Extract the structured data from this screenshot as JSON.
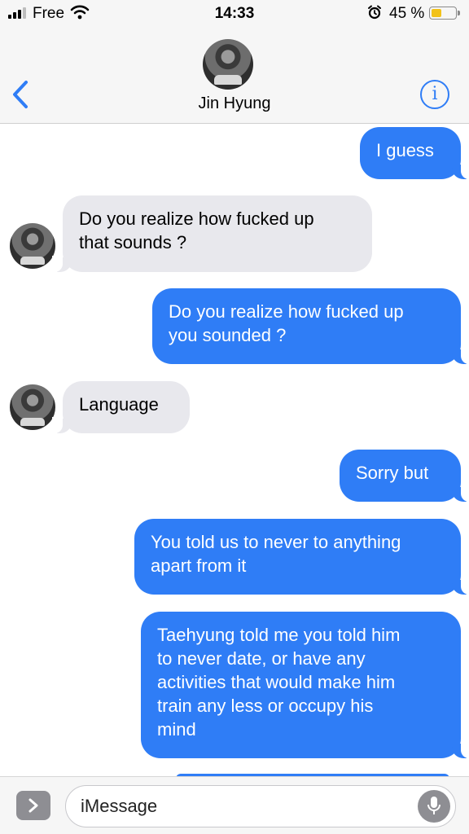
{
  "status_bar": {
    "carrier": "Free",
    "time": "14:33",
    "battery_percent": "45 %",
    "battery_level": 0.45,
    "signal_icon": "signal-bars-icon",
    "wifi_icon": "wifi-icon",
    "alarm_icon": "alarm-clock-icon"
  },
  "header": {
    "contact_name": "Jin Hyung",
    "back_icon": "chevron-left-icon",
    "info_icon": "info-icon",
    "info_glyph": "i"
  },
  "colors": {
    "outgoing_bubble": "#2f7df6",
    "incoming_bubble": "#e8e8ed",
    "accent": "#2f7df6"
  },
  "messages": [
    {
      "direction": "outgoing",
      "text": "I guess"
    },
    {
      "direction": "incoming",
      "lines": [
        "Do you realize how fucked up",
        "that sounds ?"
      ]
    },
    {
      "direction": "outgoing",
      "lines": [
        "Do you realize how fucked up",
        "you sounded ?"
      ]
    },
    {
      "direction": "incoming",
      "text": "Language"
    },
    {
      "direction": "outgoing",
      "text": "Sorry but"
    },
    {
      "direction": "outgoing",
      "lines": [
        "You told us to never to anything",
        "apart from it"
      ]
    },
    {
      "direction": "outgoing",
      "lines": [
        "Taehyung told me you told him",
        "to never date, or have any",
        "activities that would make him",
        "train any less or occupy his",
        "mind"
      ]
    }
  ],
  "composer": {
    "placeholder": "iMessage",
    "apps_icon": "chevron-right-icon",
    "mic_icon": "microphone-icon"
  }
}
